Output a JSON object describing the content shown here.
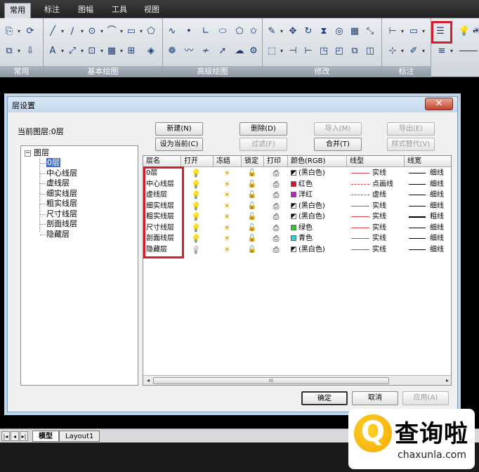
{
  "ribbon": {
    "tabs": [
      "常用",
      "标注",
      "图幅",
      "工具",
      "视图"
    ],
    "active_tab": 0,
    "panels": [
      "常用",
      "基本绘图",
      "高级绘图",
      "修改",
      "标注"
    ]
  },
  "dialog": {
    "title": "层设置",
    "close_icon": "close-icon",
    "current_layer_label": "当前图层:0层",
    "buttons": {
      "new": "新建(N)",
      "delete": "删除(D)",
      "import": "导入(M)",
      "export": "导出(E)",
      "set_current": "设为当前(C)",
      "filter": "过滤(F)",
      "merge": "合并(T)",
      "style_replace": "样式替代(V)",
      "ok": "确定",
      "cancel": "取消",
      "apply": "应用(A)"
    },
    "tree": {
      "root": "图层",
      "root_expander": "−",
      "items": [
        "0层",
        "中心线层",
        "虚线层",
        "细实线层",
        "粗实线层",
        "尺寸线层",
        "剖面线层",
        "隐藏层"
      ],
      "selected": 0
    },
    "grid": {
      "columns": [
        "层名",
        "打开",
        "冻结",
        "锁定",
        "打印",
        "颜色(RGB)",
        "线型",
        "线宽"
      ],
      "rows": [
        {
          "name": "0层",
          "color_name": "(黑白色)",
          "color_hex": "#000000",
          "linetype": "实线",
          "linetype_style": "solid",
          "lineweight": "细线",
          "lineweight_style": "thin",
          "bulb_on": true
        },
        {
          "name": "中心线层",
          "color_name": "红色",
          "color_hex": "#e0102a",
          "linetype": "点画线",
          "linetype_style": "dashdot",
          "lineweight": "细线",
          "lineweight_style": "thin",
          "bulb_on": true
        },
        {
          "name": "虚线层",
          "color_name": "洋红",
          "color_hex": "#c321c3",
          "linetype": "虚线",
          "linetype_style": "dashed",
          "lineweight": "细线",
          "lineweight_style": "thin",
          "bulb_on": true
        },
        {
          "name": "细实线层",
          "color_name": "(黑白色)",
          "color_hex": "#000000",
          "linetype": "实线",
          "linetype_style": "solid",
          "lineweight": "细线",
          "lineweight_style": "thin",
          "bulb_on": true
        },
        {
          "name": "粗实线层",
          "color_name": "(黑白色)",
          "color_hex": "#000000",
          "linetype": "实线",
          "linetype_style": "solid",
          "lineweight": "粗线",
          "lineweight_style": "thick",
          "bulb_on": true
        },
        {
          "name": "尺寸线层",
          "color_name": "绿色",
          "color_hex": "#2ad12a",
          "linetype": "实线",
          "linetype_style": "solid",
          "lineweight": "细线",
          "lineweight_style": "thin",
          "bulb_on": true
        },
        {
          "name": "剖面线层",
          "color_name": "青色",
          "color_hex": "#22d6d6",
          "linetype": "实线",
          "linetype_style": "solid",
          "lineweight": "细线",
          "lineweight_style": "thin",
          "bulb_on": true
        },
        {
          "name": "隐藏层",
          "color_name": "(黑白色)",
          "color_hex": "#000000",
          "linetype": "实线",
          "linetype_style": "solid",
          "lineweight": "细线",
          "lineweight_style": "thin",
          "bulb_on": false
        }
      ],
      "icons": {
        "on": "bulb-icon",
        "freeze": "sun-icon",
        "lock": "lock-icon",
        "print": "printer-icon"
      },
      "scroll_thumb_glyph": "III",
      "scroll_left": "◂",
      "scroll_right": "▸"
    }
  },
  "layout_tabs": {
    "nav": [
      "◂",
      "▸",
      "|◂",
      "▸|"
    ],
    "tabs": [
      "模型",
      "Layout1"
    ],
    "active": 0
  },
  "watermark": {
    "glyph": "Q",
    "title": "查询啦",
    "url": "chaxunla.com"
  },
  "colors": {
    "highlight": "#d21e2a",
    "selected": "#3a6fd1",
    "dialog_border": "#7a9cb8"
  }
}
